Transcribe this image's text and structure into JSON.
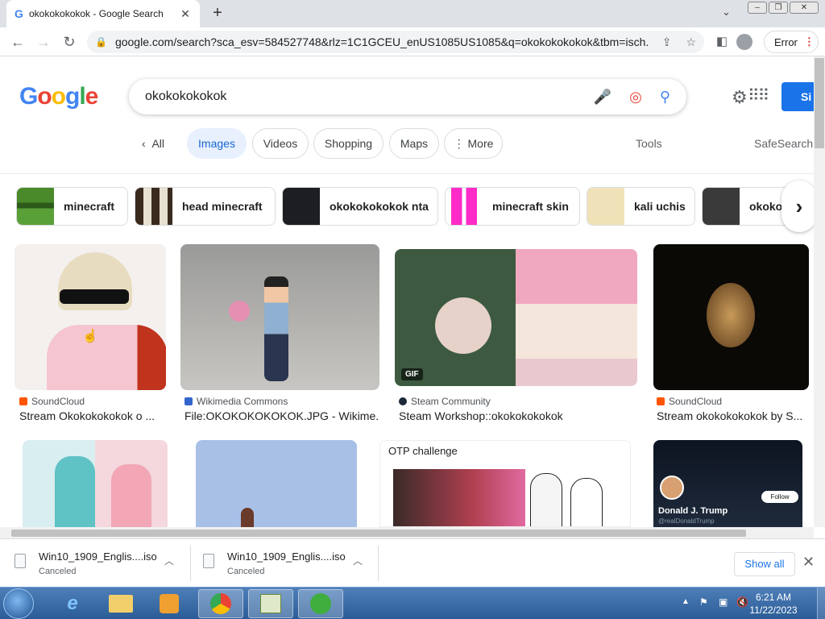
{
  "browser": {
    "tab_title": "okokokokokok - Google Search",
    "tab_favicon": "G",
    "close_tab": "✕",
    "new_tab": "+",
    "url": "google.com/search?sca_esv=584527748&rlz=1C1GCEU_enUS1085US1085&q=okokokokokok&tbm=isch...",
    "error_label": "Error"
  },
  "google": {
    "logo_letters": [
      "G",
      "o",
      "o",
      "g",
      "l",
      "e"
    ],
    "logo_colors": [
      "#4285f4",
      "#ea4335",
      "#fbbc05",
      "#4285f4",
      "#34a853",
      "#ea4335"
    ],
    "query": "okokokokokok",
    "sign_in_label": "Si"
  },
  "nav": {
    "all": "All",
    "images": "Images",
    "videos": "Videos",
    "shopping": "Shopping",
    "maps": "Maps",
    "more": "More",
    "tools": "Tools",
    "safesearch": "SafeSearch"
  },
  "related": [
    "minecraft",
    "head minecraft",
    "okokokokokok nta",
    "minecraft skin",
    "kali uchis",
    "okokok"
  ],
  "results_row1": [
    {
      "source": "SoundCloud",
      "caption": "Stream Okokokokokok o ...",
      "source_color": "#ff5500"
    },
    {
      "source": "Wikimedia Commons",
      "caption": "File:OKOKOKOKOKOK.JPG - Wikime...",
      "source_color": "#3366cc"
    },
    {
      "source": "Steam Community",
      "caption": "Steam Workshop::okokokokokok",
      "source_color": "#1b2838",
      "badge": "GIF"
    },
    {
      "source": "SoundCloud",
      "caption": "Stream okokokokokok by S...",
      "source_color": "#ff5500"
    }
  ],
  "results_row2": {
    "otp_title": "OTP challenge",
    "trump_name": "Donald J. Trump",
    "trump_handle": "@realDonaldTrump",
    "follow_label": "Follow"
  },
  "downloads": [
    {
      "file": "Win10_1909_Englis....iso",
      "status": "Canceled"
    },
    {
      "file": "Win10_1909_Englis....iso",
      "status": "Canceled"
    }
  ],
  "show_all": "Show all",
  "clock": {
    "time": "6:21 AM",
    "date": "11/22/2023"
  }
}
